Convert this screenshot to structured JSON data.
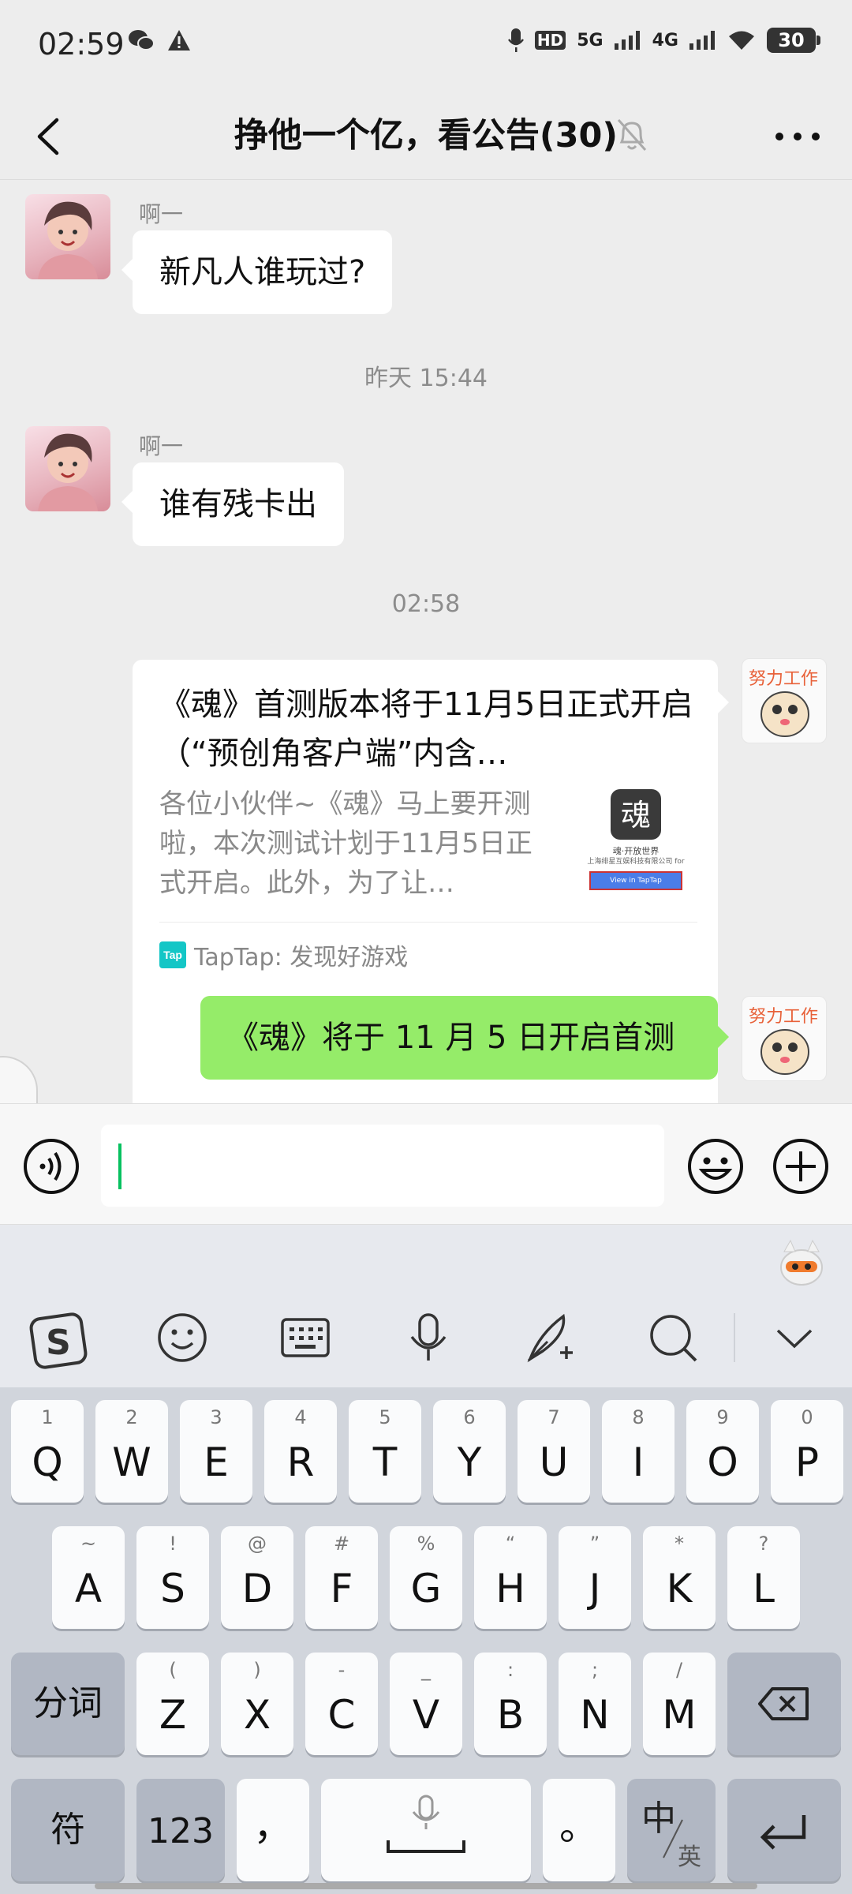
{
  "status_bar": {
    "time": "02:59",
    "hd": "HD",
    "net1": "5G",
    "net2": "4G",
    "battery": "30"
  },
  "nav": {
    "title": "挣他一个亿，看公告(30)"
  },
  "messages": [
    {
      "sender": "啊一",
      "text": "新凡人谁玩过?"
    },
    {
      "timestamp": "昨天 15:44"
    },
    {
      "sender": "啊一",
      "text": "谁有残卡出"
    },
    {
      "timestamp": "02:58"
    }
  ],
  "link_card": {
    "title": "《魂》首测版本将于11月5日正式开启（“预创角客户端”内含…",
    "description": "各位小伙伴~《魂》马上要开测啦，本次测试计划于11月5日正式开启。此外，为了让…",
    "thumb_line1": "魂·开放世界",
    "thumb_line2": "上海绯星互娱科技有限公司 for",
    "thumb_button": "View in TapTap",
    "source_logo": "Tap",
    "source": "TapTap: 发现好游戏"
  },
  "sent_message": "《魂》将于 11 月 5 日开启首测",
  "input": {
    "value": "",
    "placeholder": ""
  },
  "keyboard": {
    "row1": [
      {
        "k": "Q",
        "s": "1"
      },
      {
        "k": "W",
        "s": "2"
      },
      {
        "k": "E",
        "s": "3"
      },
      {
        "k": "R",
        "s": "4"
      },
      {
        "k": "T",
        "s": "5"
      },
      {
        "k": "Y",
        "s": "6"
      },
      {
        "k": "U",
        "s": "7"
      },
      {
        "k": "I",
        "s": "8"
      },
      {
        "k": "O",
        "s": "9"
      },
      {
        "k": "P",
        "s": "0"
      }
    ],
    "row2": [
      {
        "k": "A",
        "s": "~"
      },
      {
        "k": "S",
        "s": "!"
      },
      {
        "k": "D",
        "s": "@"
      },
      {
        "k": "F",
        "s": "#"
      },
      {
        "k": "G",
        "s": "%"
      },
      {
        "k": "H",
        "s": "“"
      },
      {
        "k": "J",
        "s": "”"
      },
      {
        "k": "K",
        "s": "*"
      },
      {
        "k": "L",
        "s": "?"
      }
    ],
    "row3": [
      {
        "k": "Z",
        "s": "("
      },
      {
        "k": "X",
        "s": ")"
      },
      {
        "k": "C",
        "s": "-"
      },
      {
        "k": "V",
        "s": "_"
      },
      {
        "k": "B",
        "s": ":"
      },
      {
        "k": "N",
        "s": ";"
      },
      {
        "k": "M",
        "s": "/"
      }
    ],
    "fenci": "分词",
    "fu": "符",
    "num": "123",
    "comma": "，",
    "period": "。",
    "zh": "中",
    "en": "英"
  },
  "colors": {
    "accent_green": "#95ec69",
    "cursor_green": "#07c160",
    "taptap": "#14c6c6"
  },
  "icons": [
    "back-icon",
    "mute-bell-icon",
    "more-icon",
    "voice-icon",
    "emoji-icon",
    "plus-icon",
    "sogou-icon",
    "smile-icon",
    "keyboard-icon",
    "mic-icon",
    "handwrite-icon",
    "search-icon",
    "collapse-icon",
    "backspace-icon",
    "enter-icon",
    "space-mic-icon"
  ]
}
